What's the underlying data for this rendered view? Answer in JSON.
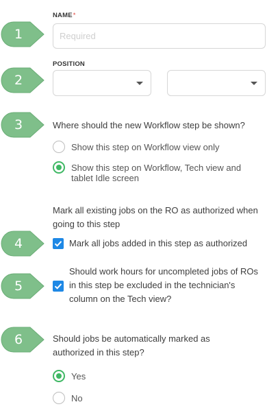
{
  "markers": [
    "1",
    "2",
    "3",
    "4",
    "5",
    "6"
  ],
  "colors": {
    "marker": "#7fbf8a",
    "radio_accent": "#3fb864",
    "checkbox": "#1e88e5",
    "required_asterisk": "#e0413a"
  },
  "name_field": {
    "label": "NAME",
    "required_mark": "*",
    "placeholder": "Required",
    "value": ""
  },
  "position_field": {
    "label": "POSITION",
    "select_1_value": "",
    "select_2_value": ""
  },
  "show_step": {
    "question": "Where should the new Workflow step be shown?",
    "options": [
      {
        "label": "Show this step on Workflow view only",
        "selected": false
      },
      {
        "label": "Show this step on Workflow, Tech view and tablet Idle screen",
        "selected": true
      }
    ]
  },
  "authorize_existing": {
    "description": "Mark all existing jobs on the RO as authorized when going to this step",
    "checkbox_label": "Mark all jobs added in this step as authorized",
    "checked": true
  },
  "exclude_hours": {
    "checkbox_label": "Should work hours for uncompleted jobs of ROs in this step be excluded in the technician's column on the Tech view?",
    "checked": true
  },
  "auto_authorize": {
    "question": "Should jobs be automatically marked as authorized in this step?",
    "options": [
      {
        "label": "Yes",
        "selected": true
      },
      {
        "label": "No",
        "selected": false
      }
    ]
  }
}
